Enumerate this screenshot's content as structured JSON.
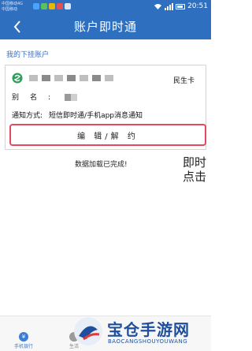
{
  "statusbar": {
    "carrier_top": "中国移动4G",
    "carrier_bottom": "中国移动",
    "time": "20:51"
  },
  "header": {
    "title": "账户即时通"
  },
  "main": {
    "section_label": "我的下挂账户",
    "account": {
      "card_type": "民生卡",
      "name_label": "别名:",
      "notify_label": "通知方式:",
      "notify_value": "短信即时通/手机app消息通知"
    },
    "edit_button_label": "编 辑/解 约",
    "status_text": "数据加载已完成!",
    "hint_line1": "即时",
    "hint_line2": "点击"
  },
  "bottomnav": {
    "item1_label": "手机银行",
    "item2_label": "生活"
  },
  "watermark": {
    "title": "宝仓手游网",
    "subtitle": "BAOCANGSHOUYOUWANG"
  },
  "colors": {
    "header_bg": "#2f6fc0",
    "accent_blue": "#3a6ec2",
    "highlight_red": "#e44a5e"
  }
}
